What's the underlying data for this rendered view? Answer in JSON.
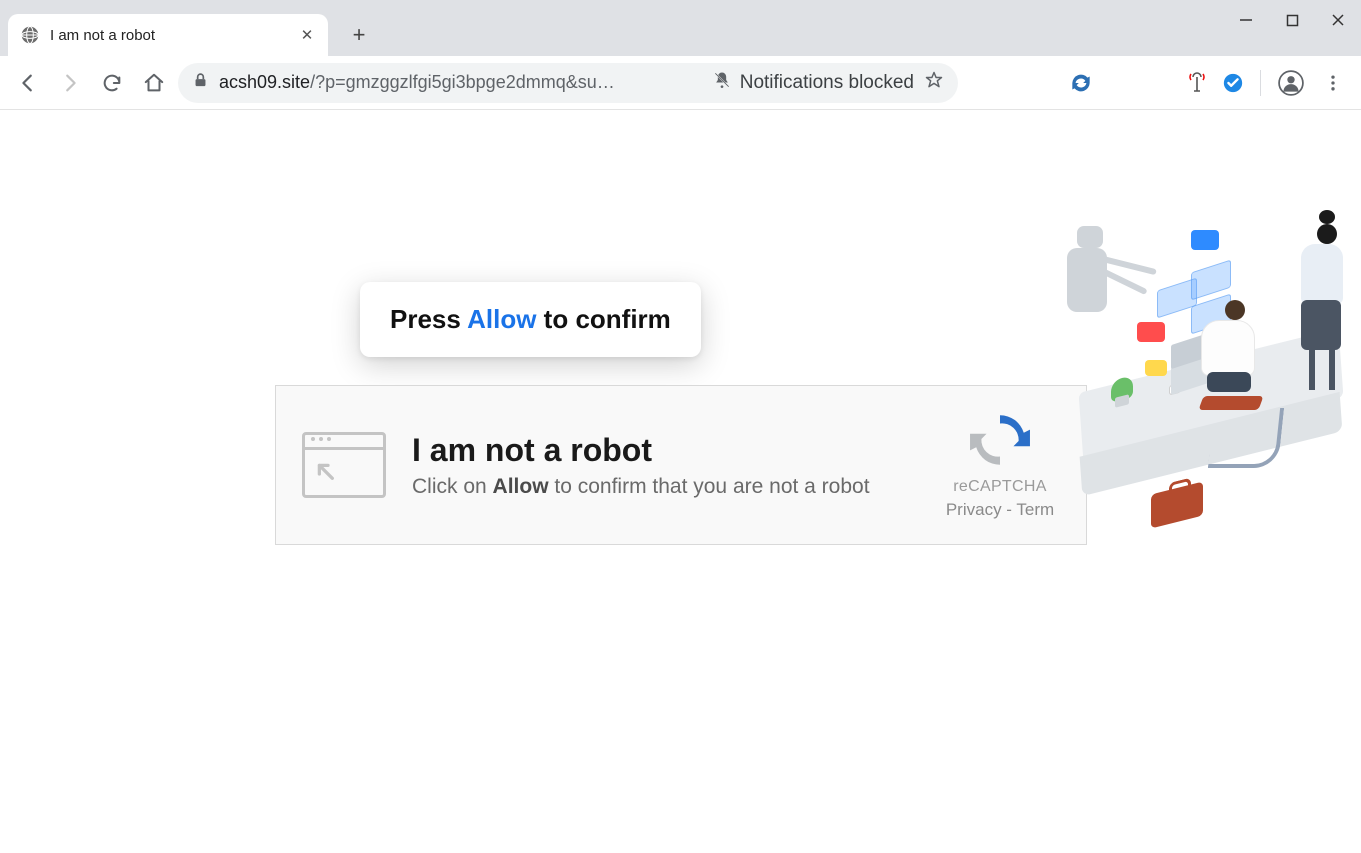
{
  "window": {
    "tab_title": "I am not a robot",
    "minimize_glyph": "—",
    "maximize_glyph": "☐",
    "close_glyph": "✕",
    "newtab_glyph": "+",
    "closetab_glyph": "✕"
  },
  "toolbar": {
    "url_secure_prefix": "acsh09.site",
    "url_rest": "/?p=gmzggzlfgi5gi3bpge2dmmq&su…",
    "notifications_label": "Notifications blocked"
  },
  "page": {
    "tooltip_prefix": "Press ",
    "tooltip_allow": "Allow",
    "tooltip_suffix": " to confirm",
    "headline": "I am not a robot",
    "sub_prefix": "Click on ",
    "sub_bold": "Allow",
    "sub_suffix": " to confirm that you are not a robot",
    "recaptcha_brand": "reCAPTCHA",
    "recaptcha_links": "Privacy - Term"
  }
}
